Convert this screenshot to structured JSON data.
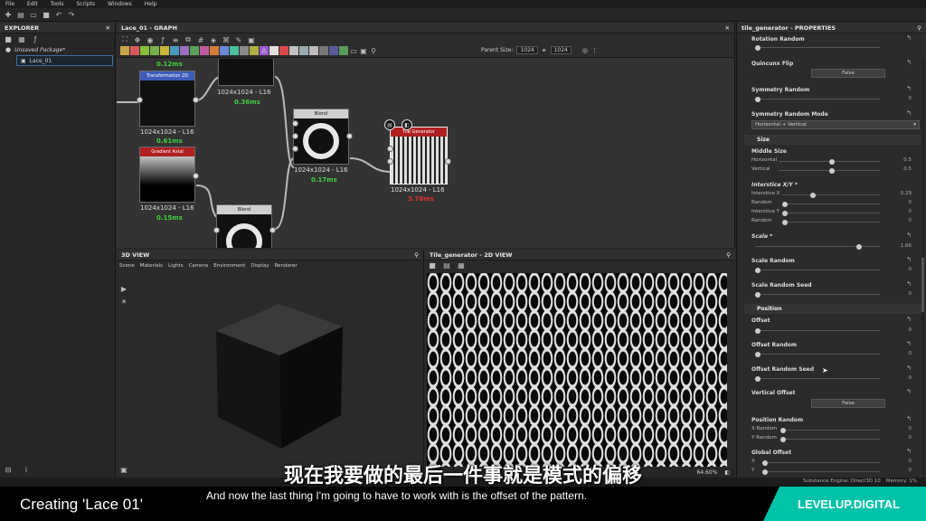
{
  "menu": [
    "File",
    "Edit",
    "Tools",
    "Scripts",
    "Windows",
    "Help"
  ],
  "explorer": {
    "title": "EXPLORER",
    "package": "Unsaved Package*",
    "item": "Lace_01"
  },
  "graph": {
    "title": "Lace_01 - GRAPH",
    "parent_size_label": "Parent Size:",
    "size_a": "1024",
    "size_b": "1024",
    "nodes": {
      "top_time": "0.12ms",
      "transform_hdr": "Transformation 2D",
      "transform_label": "1024x1024 - L16",
      "transform_time": "0.61ms",
      "top2_label": "1024x1024 - L16",
      "top2_time": "0.36ms",
      "gradient_hdr": "Gradient Axial",
      "gradient_label": "1024x1024 - L16",
      "gradient_time": "0.15ms",
      "blend1_hdr": "Blend",
      "blend1_label": "1024x1024 - L16",
      "blend1_time": "0.17ms",
      "blend2_hdr": "Blend",
      "tile_hdr": "Tile Generator",
      "tile_label": "1024x1024 - L16",
      "tile_time": "3.78ms"
    }
  },
  "view3d": {
    "title": "3D VIEW",
    "menu": [
      "Scene",
      "Materials",
      "Lights",
      "Camera",
      "Environment",
      "Display",
      "Renderer"
    ]
  },
  "view2d": {
    "title": "Tile_generator - 2D VIEW",
    "zoom": "64.60%"
  },
  "props": {
    "title": "tile_generator - PROPERTIES",
    "rotation_random": "Rotation Random",
    "quincunx": "Quincunx Flip",
    "quincunx_val": "False",
    "symmetry_random": "Symmetry Random",
    "symmetry_random_val": "0",
    "symmetry_mode": "Symmetry Random Mode",
    "symmetry_mode_val": "Horizontal + Vertical",
    "size_section": "Size",
    "middle_size": "Middle Size",
    "horizontal": "Horizontal",
    "horizontal_val": "0.5",
    "vertical": "Vertical",
    "vertical_val": "0.5",
    "interstice": "Interstice X/Y *",
    "interstice_x": "Interstice X",
    "interstice_x_val": "0.29",
    "random1": "Random",
    "random1_val": "0",
    "interstice_y": "Interstice Y",
    "interstice_y_val": "0",
    "random2": "Random",
    "random2_val": "0",
    "scale": "Scale *",
    "scale_val": "1.66",
    "scale_random": "Scale Random",
    "scale_random_val": "0",
    "scale_random_seed": "Scale Random Seed",
    "scale_random_seed_val": "0",
    "position_section": "Position",
    "offset": "Offset",
    "offset_val": "0",
    "offset_random": "Offset Random",
    "offset_random_val": "0",
    "offset_random_seed": "Offset Random Seed",
    "offset_random_seed_val": "0",
    "vertical_offset": "Vertical Offset",
    "vertical_offset_val": "False",
    "position_random": "Position Random",
    "x_random": "X Random",
    "x_random_val": "0",
    "y_random": "Y Random",
    "y_random_val": "0",
    "global_offset": "Global Offset",
    "gx": "X",
    "gx_val": "0",
    "gy": "Y",
    "gy_val": "0"
  },
  "status": {
    "engine": "Substance Engine: Direct3D 10",
    "memory": "Memory: 1%"
  },
  "caption": {
    "course": "Creating 'Lace 01'",
    "subtitle_cn": "现在我要做的最后一件事就是模式的偏移",
    "subtitle_en": "And now the last thing I'm going to have to work with is the offset of the pattern.",
    "brand": "LEVELUP.DIGITAL"
  }
}
